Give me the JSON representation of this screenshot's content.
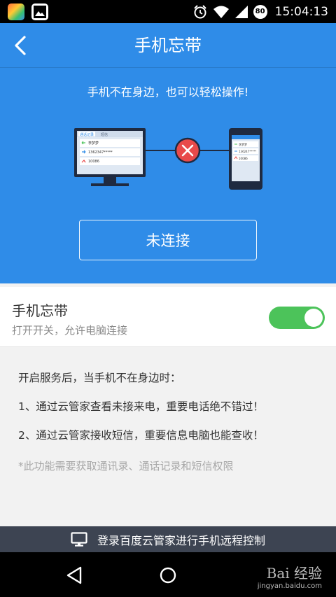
{
  "status_bar": {
    "time": "15:04:13",
    "battery": "80",
    "icons": [
      "app-shortcut-icon",
      "gallery-icon",
      "alarm-icon",
      "wifi-icon",
      "signal-icon",
      "battery-icon"
    ]
  },
  "header": {
    "title": "手机忘带",
    "back_icon": "back-arrow-icon"
  },
  "hero": {
    "subtitle": "手机不在身边，也可以轻松操作!",
    "connection_status": "未连接",
    "pc_panel": {
      "tabs": [
        "通话记录",
        "短信"
      ],
      "rows": [
        {
          "text": "李梦梦",
          "mark": "incoming"
        },
        {
          "text": "1362347*****",
          "mark": "outgoing"
        },
        {
          "text": "10086",
          "mark": "missed"
        }
      ]
    },
    "phone_panel": {
      "rows": [
        "李梦梦",
        "136247*****",
        "10086"
      ]
    }
  },
  "setting": {
    "title": "手机忘带",
    "subtitle": "打开开关，允许电脑连接",
    "enabled": true
  },
  "info": {
    "heading": "开启服务后，当手机不在身边时：",
    "items": [
      "1、通过云管家查看未接来电，重要电话绝不错过！",
      "2、通过云管家接收短信，重要信息电脑也能查收！"
    ],
    "note": "*此功能需要获取通讯录、通话记录和短信权限"
  },
  "bottom_bar": {
    "label": "登录百度云管家进行手机远程控制",
    "icon": "monitor-icon"
  },
  "nav": {
    "watermark_top": "Bai 经验",
    "watermark_bottom": "jingyan.baidu.com"
  },
  "colors": {
    "primary": "#2f8ce8",
    "toggle_on": "#4cc35a",
    "error": "#e84a4a",
    "bottom_bar": "#3d4452"
  }
}
